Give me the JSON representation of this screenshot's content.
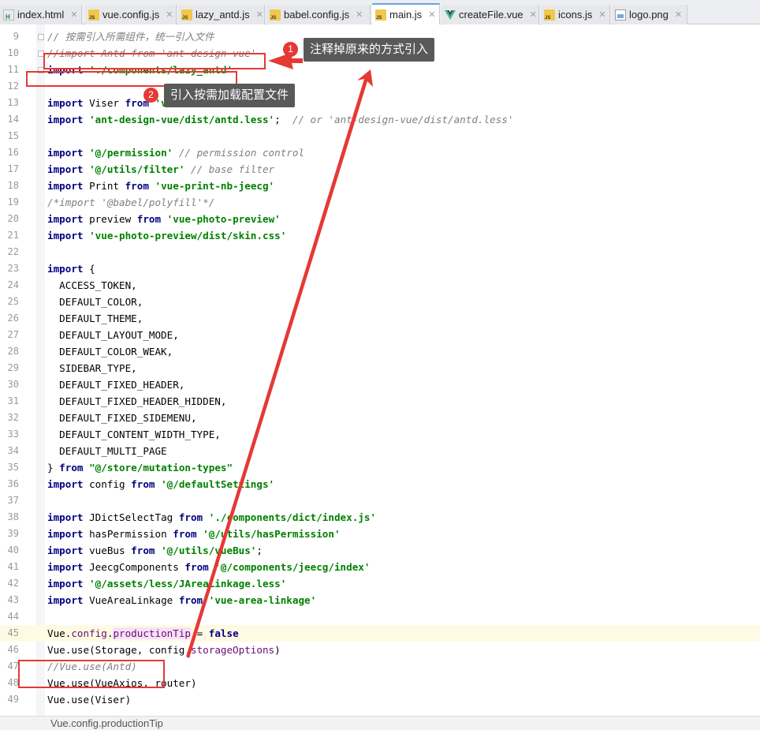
{
  "tabs": [
    {
      "label": "index.html",
      "icon": "html-file-icon",
      "active": false
    },
    {
      "label": "vue.config.js",
      "icon": "js-file-icon",
      "active": false
    },
    {
      "label": "lazy_antd.js",
      "icon": "js-file-icon",
      "active": false
    },
    {
      "label": "babel.config.js",
      "icon": "js-file-icon",
      "active": false
    },
    {
      "label": "main.js",
      "icon": "js-file-icon",
      "active": true
    },
    {
      "label": "createFile.vue",
      "icon": "vue-file-icon",
      "active": false
    },
    {
      "label": "icons.js",
      "icon": "js-file-icon",
      "active": false
    },
    {
      "label": "logo.png",
      "icon": "png-file-icon",
      "active": false
    }
  ],
  "editor": {
    "current_line": 45,
    "lines": [
      {
        "n": "9",
        "tokens": [
          [
            "cm",
            "// 按需引入所需组件，统一引入文件"
          ]
        ]
      },
      {
        "n": "10",
        "tokens": [
          [
            "cm",
            "//import Antd from 'ant-design-vue'"
          ]
        ]
      },
      {
        "n": "11",
        "tokens": [
          [
            "kw",
            "import "
          ],
          [
            "str",
            "'./components/lazy_antd'"
          ]
        ]
      },
      {
        "n": "12",
        "tokens": []
      },
      {
        "n": "13",
        "tokens": [
          [
            "kw",
            "import "
          ],
          [
            "",
            "Viser "
          ],
          [
            "kw",
            "from "
          ],
          [
            "str",
            "'viser-vue'"
          ]
        ]
      },
      {
        "n": "14",
        "tokens": [
          [
            "kw",
            "import "
          ],
          [
            "str",
            "'ant-design-vue/dist/antd.less'"
          ],
          [
            "",
            ";  "
          ],
          [
            "cm",
            "// or 'ant-design-vue/dist/antd.less'"
          ]
        ]
      },
      {
        "n": "15",
        "tokens": []
      },
      {
        "n": "16",
        "tokens": [
          [
            "kw",
            "import "
          ],
          [
            "str",
            "'@/permission'"
          ],
          [
            "cm",
            " // permission control"
          ]
        ]
      },
      {
        "n": "17",
        "tokens": [
          [
            "kw",
            "import "
          ],
          [
            "str",
            "'@/utils/filter'"
          ],
          [
            "cm",
            " // base filter"
          ]
        ]
      },
      {
        "n": "18",
        "tokens": [
          [
            "kw",
            "import "
          ],
          [
            "",
            "Print "
          ],
          [
            "kw",
            "from "
          ],
          [
            "str",
            "'vue-print-nb-jeecg'"
          ]
        ]
      },
      {
        "n": "19",
        "tokens": [
          [
            "cm",
            "/*import '@babel/polyfill'*/"
          ]
        ]
      },
      {
        "n": "20",
        "tokens": [
          [
            "kw",
            "import "
          ],
          [
            "",
            "preview "
          ],
          [
            "kw",
            "from "
          ],
          [
            "str",
            "'vue-photo-preview'"
          ]
        ]
      },
      {
        "n": "21",
        "tokens": [
          [
            "kw",
            "import "
          ],
          [
            "str",
            "'vue-photo-preview/dist/skin.css'"
          ]
        ]
      },
      {
        "n": "22",
        "tokens": []
      },
      {
        "n": "23",
        "tokens": [
          [
            "kw",
            "import "
          ],
          [
            "",
            "{"
          ]
        ]
      },
      {
        "n": "24",
        "tokens": [
          [
            "",
            "  ACCESS_TOKEN,"
          ]
        ]
      },
      {
        "n": "25",
        "tokens": [
          [
            "",
            "  DEFAULT_COLOR,"
          ]
        ]
      },
      {
        "n": "26",
        "tokens": [
          [
            "",
            "  DEFAULT_THEME,"
          ]
        ]
      },
      {
        "n": "27",
        "tokens": [
          [
            "",
            "  DEFAULT_LAYOUT_MODE,"
          ]
        ]
      },
      {
        "n": "28",
        "tokens": [
          [
            "",
            "  DEFAULT_COLOR_WEAK,"
          ]
        ]
      },
      {
        "n": "29",
        "tokens": [
          [
            "",
            "  SIDEBAR_TYPE,"
          ]
        ]
      },
      {
        "n": "30",
        "tokens": [
          [
            "",
            "  DEFAULT_FIXED_HEADER,"
          ]
        ]
      },
      {
        "n": "31",
        "tokens": [
          [
            "",
            "  DEFAULT_FIXED_HEADER_HIDDEN,"
          ]
        ]
      },
      {
        "n": "32",
        "tokens": [
          [
            "",
            "  DEFAULT_FIXED_SIDEMENU,"
          ]
        ]
      },
      {
        "n": "33",
        "tokens": [
          [
            "",
            "  DEFAULT_CONTENT_WIDTH_TYPE,"
          ]
        ]
      },
      {
        "n": "34",
        "tokens": [
          [
            "",
            "  DEFAULT_MULTI_PAGE"
          ]
        ]
      },
      {
        "n": "35",
        "tokens": [
          [
            "",
            "} "
          ],
          [
            "kw",
            "from "
          ],
          [
            "str",
            "\"@/store/mutation-types\""
          ]
        ]
      },
      {
        "n": "36",
        "tokens": [
          [
            "kw",
            "import "
          ],
          [
            "",
            "config "
          ],
          [
            "kw",
            "from "
          ],
          [
            "str",
            "'@/defaultSettings'"
          ]
        ]
      },
      {
        "n": "37",
        "tokens": []
      },
      {
        "n": "38",
        "tokens": [
          [
            "kw",
            "import "
          ],
          [
            "",
            "JDictSelectTag "
          ],
          [
            "kw",
            "from "
          ],
          [
            "str",
            "'./components/dict/index.js'"
          ]
        ]
      },
      {
        "n": "39",
        "tokens": [
          [
            "kw",
            "import "
          ],
          [
            "",
            "hasPermission "
          ],
          [
            "kw",
            "from "
          ],
          [
            "str",
            "'@/utils/hasPermission'"
          ]
        ]
      },
      {
        "n": "40",
        "tokens": [
          [
            "kw",
            "import "
          ],
          [
            "",
            "vueBus "
          ],
          [
            "kw",
            "from "
          ],
          [
            "str",
            "'@/utils/vueBus'"
          ],
          [
            "",
            ";"
          ]
        ]
      },
      {
        "n": "41",
        "tokens": [
          [
            "kw",
            "import "
          ],
          [
            "",
            "JeecgComponents "
          ],
          [
            "kw",
            "from "
          ],
          [
            "str",
            "'@/components/jeecg/index'"
          ]
        ]
      },
      {
        "n": "42",
        "tokens": [
          [
            "kw",
            "import "
          ],
          [
            "str",
            "'@/assets/less/JAreaLinkage.less'"
          ]
        ]
      },
      {
        "n": "43",
        "tokens": [
          [
            "kw",
            "import "
          ],
          [
            "",
            "VueAreaLinkage "
          ],
          [
            "kw",
            "from "
          ],
          [
            "str",
            "'vue-area-linkage'"
          ]
        ]
      },
      {
        "n": "44",
        "tokens": []
      },
      {
        "n": "45",
        "tokens": [
          [
            "",
            "Vue."
          ],
          [
            "prop",
            "config"
          ],
          [
            "",
            "."
          ],
          [
            "hl",
            "productionTip"
          ],
          [
            "",
            " = "
          ],
          [
            "kw",
            "false"
          ]
        ]
      },
      {
        "n": "46",
        "tokens": [
          [
            "",
            "Vue.use(Storage, config."
          ],
          [
            "prop",
            "storageOptions"
          ],
          [
            "",
            ")"
          ]
        ]
      },
      {
        "n": "47",
        "tokens": [
          [
            "cm",
            "//Vue.use(Antd)"
          ]
        ]
      },
      {
        "n": "48",
        "tokens": [
          [
            "",
            "Vue.use(VueAxios, router)"
          ]
        ]
      },
      {
        "n": "49",
        "tokens": [
          [
            "",
            "Vue.use(Viser)"
          ]
        ]
      }
    ]
  },
  "annotations": {
    "callout1": {
      "badge": "1",
      "text": "注释掉原来的方式引入"
    },
    "callout2": {
      "badge": "2",
      "text": "引入按需加载配置文件"
    },
    "color": "#e53935"
  },
  "status_bar": {
    "text": "Vue.config.productionTip"
  }
}
